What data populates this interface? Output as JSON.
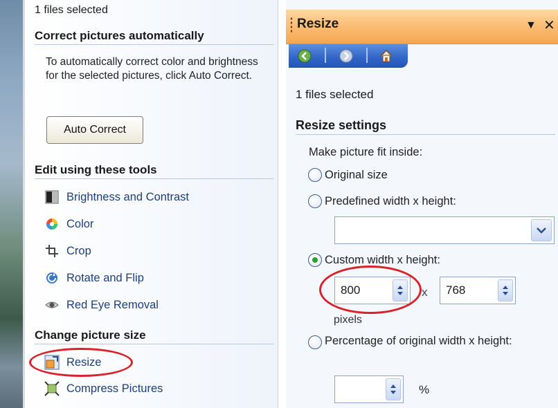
{
  "left_pane": {
    "selected_count": "1 files selected",
    "sections": {
      "auto": "Correct pictures automatically",
      "edit": "Edit using these tools",
      "size": "Change picture size"
    },
    "auto_description": "To automatically correct color and brightness for the selected pictures, click Auto Correct.",
    "auto_correct_button": "Auto Correct",
    "tools": [
      {
        "label": "Brightness and Contrast",
        "icon": "brightness-contrast-icon"
      },
      {
        "label": "Color",
        "icon": "color-wheel-icon"
      },
      {
        "label": "Crop",
        "icon": "crop-icon"
      },
      {
        "label": "Rotate and Flip",
        "icon": "rotate-icon"
      },
      {
        "label": "Red Eye Removal",
        "icon": "red-eye-icon"
      }
    ],
    "size_tools": [
      {
        "label": "Resize",
        "icon": "resize-icon"
      },
      {
        "label": "Compress Pictures",
        "icon": "compress-icon"
      }
    ]
  },
  "right_pane": {
    "title": "Resize",
    "menu_glyph": "▼",
    "close_glyph": "✕",
    "selected_count": "1 files selected",
    "section_heading": "Resize settings",
    "fit_label": "Make picture fit inside:",
    "options": {
      "original": "Original size",
      "predefined": "Predefined width x height:",
      "custom": "Custom width x height:",
      "percentage": "Percentage of original width x height:"
    },
    "selected_option": "custom",
    "custom_width": "800",
    "custom_height": "768",
    "times_sign": "x",
    "units_label": "pixels",
    "percent_value": "",
    "percent_sign": "%"
  },
  "colors": {
    "titlebar_orange": "#f5a650",
    "nav_blue": "#2f63c5",
    "link_blue": "#1d3f7a",
    "annotation_red": "#d8232a"
  }
}
